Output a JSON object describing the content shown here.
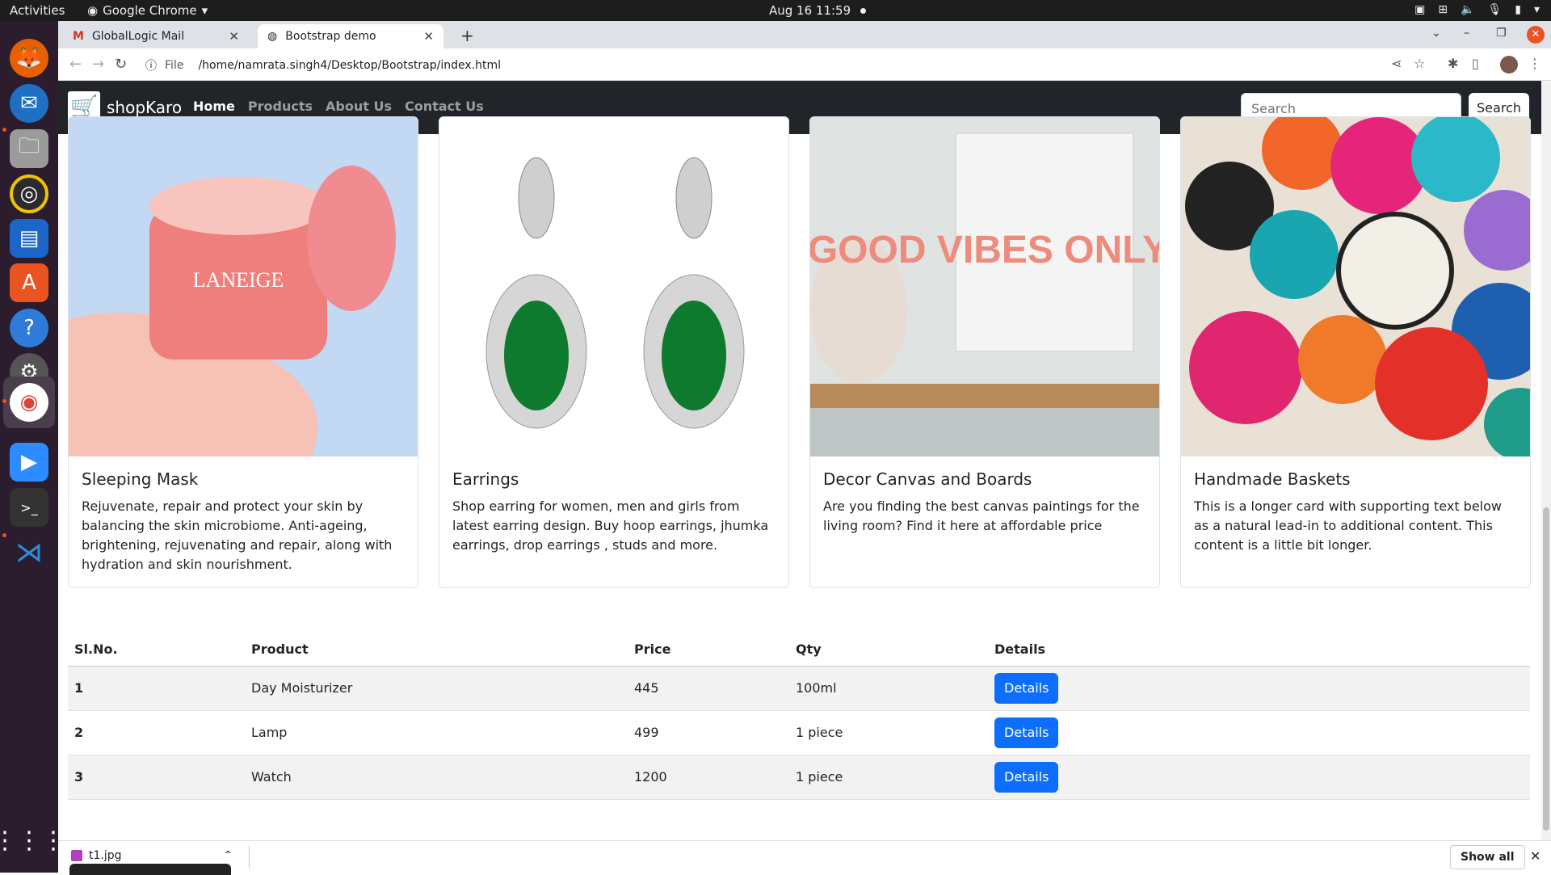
{
  "system": {
    "activities": "Activities",
    "app_name": "Google Chrome",
    "datetime": "Aug 16  11:59"
  },
  "browser": {
    "tabs": [
      {
        "title": "GlobalLogic Mail",
        "icon": "gmail-icon"
      },
      {
        "title": "Bootstrap demo",
        "icon": "globe-icon"
      }
    ],
    "address_label": "File",
    "url": "/home/namrata.singh4/Desktop/Bootstrap/index.html"
  },
  "site": {
    "brand": "shopKaro",
    "nav": [
      "Home",
      "Products",
      "About Us",
      "Contact Us"
    ],
    "search_placeholder": "Search",
    "search_button": "Search"
  },
  "cards": [
    {
      "title": "Sleeping Mask",
      "text": "Rejuvenate, repair and protect your skin by balancing the skin microbiome. Anti-ageing, brightening, rejuvenating and repair, along with hydration and skin nourishment.",
      "image_text": "LANEIGE"
    },
    {
      "title": "Earrings",
      "text": "Shop earring for women, men and girls from latest earring design. Buy hoop earrings, jhumka earrings, drop earrings , studs and more."
    },
    {
      "title": "Decor Canvas and Boards",
      "text": "Are you finding the best canvas paintings for the living room? Find it here at affordable price",
      "image_text": "GOOD VIBES ONLY"
    },
    {
      "title": "Handmade Baskets",
      "text": "This is a longer card with supporting text below as a natural lead-in to additional content. This content is a little bit longer."
    }
  ],
  "table": {
    "headers": [
      "Sl.No.",
      "Product",
      "Price",
      "Qty",
      "Details"
    ],
    "rows": [
      {
        "no": "1",
        "product": "Day Moisturizer",
        "price": "445",
        "qty": "100ml",
        "button": "Details"
      },
      {
        "no": "2",
        "product": "Lamp",
        "price": "499",
        "qty": "1 piece",
        "button": "Details"
      },
      {
        "no": "3",
        "product": "Watch",
        "price": "1200",
        "qty": "1 piece",
        "button": "Details"
      }
    ]
  },
  "downloads": {
    "file": "t1.jpg",
    "show_all": "Show all"
  },
  "colors": {
    "navbar": "#212529",
    "primary_button": "#0d6efd",
    "ubuntu_accent": "#e95420"
  }
}
